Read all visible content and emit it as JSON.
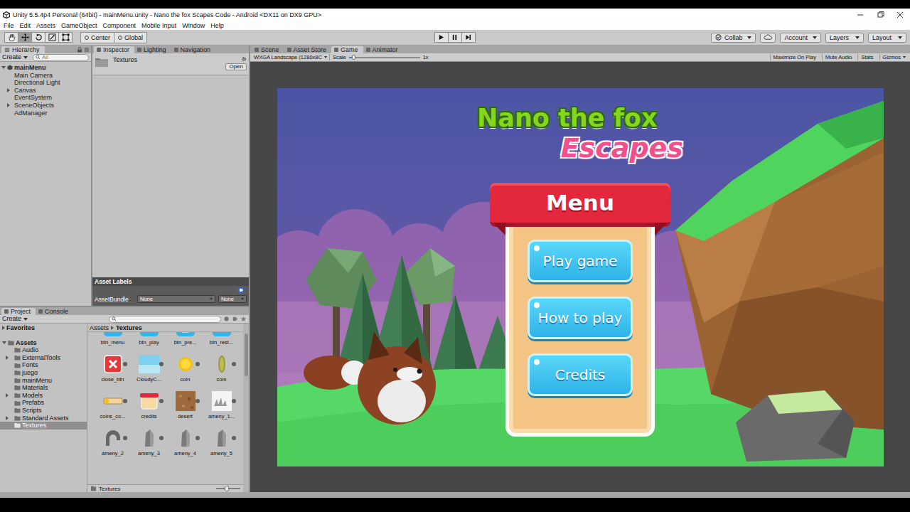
{
  "window": {
    "title": "Unity 5.5.4p4 Personal (64bit) - mainMenu.unity - Nano the fox Scapes Code - Android <DX11 on DX9 GPU>"
  },
  "menu": [
    "File",
    "Edit",
    "Assets",
    "GameObject",
    "Component",
    "Mobile Input",
    "Window",
    "Help"
  ],
  "toolbar": {
    "tools": [
      {
        "kind": "hand",
        "selected": false
      },
      {
        "kind": "move",
        "selected": true
      },
      {
        "kind": "rotate",
        "selected": false
      },
      {
        "kind": "scale",
        "selected": false
      },
      {
        "kind": "rect",
        "selected": false
      }
    ],
    "pivot": [
      "Center",
      "Global"
    ],
    "play": {
      "playing": false,
      "paused": false
    },
    "collab": "Collab",
    "account": "Account",
    "layers": "Layers",
    "layout": "Layout"
  },
  "hierarchy": {
    "tab": "Hierarchy",
    "create": "Create",
    "search": "All",
    "scene": {
      "name": "mainMenu",
      "expanded": true
    },
    "items": [
      {
        "label": "Main Camera",
        "expandable": false,
        "expanded": false
      },
      {
        "label": "Directional Light",
        "expandable": false,
        "expanded": false
      },
      {
        "label": "Canvas",
        "expandable": true,
        "expanded": false
      },
      {
        "label": "EventSystem",
        "expandable": false,
        "expanded": false
      },
      {
        "label": "SceneObjects",
        "expandable": true,
        "expanded": false
      },
      {
        "label": "AdManager",
        "expandable": false,
        "expanded": false
      }
    ]
  },
  "inspector": {
    "tabs": [
      {
        "label": "Inspector",
        "selected": true
      },
      {
        "label": "Lighting",
        "selected": false
      },
      {
        "label": "Navigation",
        "selected": false
      }
    ],
    "asset": "Textures",
    "open_button": "Open",
    "asset_labels": {
      "title": "Asset Labels",
      "field": "AssetBundle",
      "values": [
        "None",
        "None"
      ]
    }
  },
  "project": {
    "tabs": [
      {
        "label": "Project",
        "selected": true
      },
      {
        "label": "Console",
        "selected": false
      }
    ],
    "create": "Create",
    "favorites": {
      "label": "Favorites",
      "expanded": false
    },
    "assets": {
      "label": "Assets",
      "expanded": true,
      "children": [
        {
          "label": "Audio",
          "expandable": false,
          "selected": false
        },
        {
          "label": "ExternalTools",
          "expandable": true,
          "selected": false
        },
        {
          "label": "Fonts",
          "expandable": false,
          "selected": false
        },
        {
          "label": "juego",
          "expandable": false,
          "selected": false
        },
        {
          "label": "mainMenu",
          "expandable": false,
          "selected": false
        },
        {
          "label": "Materials",
          "expandable": false,
          "selected": false
        },
        {
          "label": "Models",
          "expandable": true,
          "selected": false
        },
        {
          "label": "Prefabs",
          "expandable": false,
          "selected": false
        },
        {
          "label": "Scripts",
          "expandable": false,
          "selected": false
        },
        {
          "label": "Standard Assets",
          "expandable": true,
          "selected": false
        },
        {
          "label": "Textures",
          "expandable": false,
          "selected": true
        }
      ]
    },
    "breadcrumb": [
      "Assets",
      "Textures"
    ],
    "items": [
      {
        "name": "btn_menu",
        "kind": "menu"
      },
      {
        "name": "btn_play",
        "kind": "play"
      },
      {
        "name": "btn_pre...",
        "kind": "trophy"
      },
      {
        "name": "btn_rest...",
        "kind": "restart"
      },
      {
        "name": "close_btn",
        "kind": "close"
      },
      {
        "name": "CloudyC...",
        "kind": "sky"
      },
      {
        "name": "coin",
        "kind": "coin"
      },
      {
        "name": "coin",
        "kind": "coinside"
      },
      {
        "name": "coins_co...",
        "kind": "bar"
      },
      {
        "name": "credits",
        "kind": "card"
      },
      {
        "name": "desert",
        "kind": "sand"
      },
      {
        "name": "ameny_1...",
        "kind": "sprites"
      },
      {
        "name": "ameny_2",
        "kind": "arch"
      },
      {
        "name": "ameny_3",
        "kind": "rock"
      },
      {
        "name": "ameny_4",
        "kind": "rock"
      },
      {
        "name": "ameny_5",
        "kind": "rock"
      }
    ],
    "footer": "Textures"
  },
  "game_view": {
    "tabs": [
      {
        "label": "Scene",
        "selected": false
      },
      {
        "label": "Asset Store",
        "selected": false
      },
      {
        "label": "Game",
        "selected": true
      },
      {
        "label": "Animator",
        "selected": false
      }
    ],
    "resolution": "WXGA Landscape (1280x8C",
    "scale_label": "Scale",
    "scale_level": 0.04,
    "scale_value": "1x",
    "toggles": [
      {
        "label": "Maximize On Play",
        "on": false
      },
      {
        "label": "Mute Audio",
        "on": false
      },
      {
        "label": "Stats",
        "on": false
      }
    ],
    "gizmos": "Gizmos",
    "game": {
      "title": "Nano the fox",
      "subtitle": "Escapes",
      "menu_title": "Menu",
      "buttons": [
        "Play game",
        "How to play",
        "Credits"
      ]
    }
  }
}
